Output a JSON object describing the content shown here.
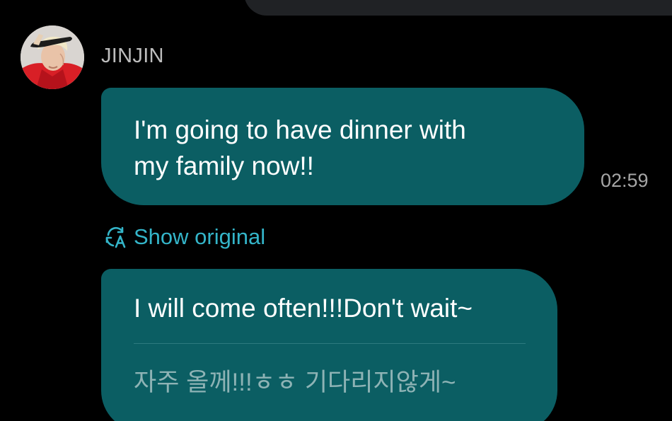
{
  "header": {
    "previous_bubble": ""
  },
  "sender": {
    "name": "JINJIN",
    "avatar": "profile-photo"
  },
  "messages": [
    {
      "text_line1": "I'm going to have dinner with",
      "text_line2": "my family now!!",
      "time": "02:59"
    },
    {
      "translated": "I will come often!!!Don't wait~",
      "original": "자주 올께!!!ㅎㅎ 기다리지않게~"
    }
  ],
  "translation_toggle": {
    "label": "Show original",
    "icon": "translate-icon"
  },
  "colors": {
    "background": "#000000",
    "bubble": "#0b5e63",
    "link": "#34b5c9",
    "timestamp": "#a6a6a6",
    "name": "#bdbdbd",
    "original_text": "#8eb3b5"
  }
}
